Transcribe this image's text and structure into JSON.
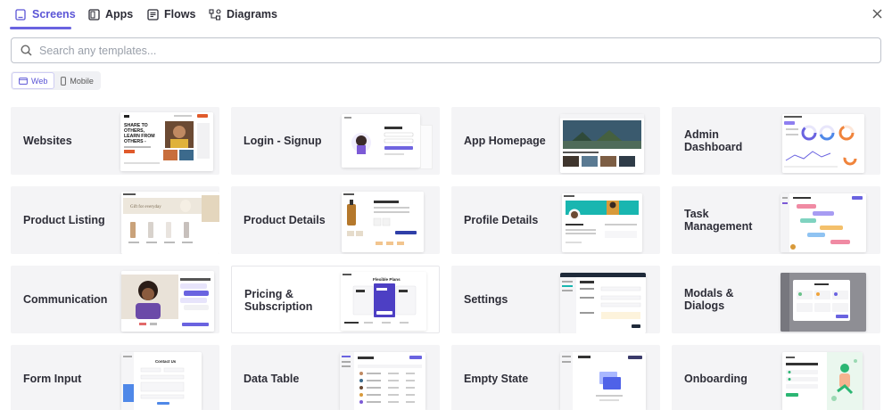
{
  "tabs": [
    {
      "label": "Screens",
      "icon": "screens-icon",
      "active": true
    },
    {
      "label": "Apps",
      "icon": "apps-icon",
      "active": false
    },
    {
      "label": "Flows",
      "icon": "flows-icon",
      "active": false
    },
    {
      "label": "Diagrams",
      "icon": "diagrams-icon",
      "active": false
    }
  ],
  "search": {
    "placeholder": "Search any templates..."
  },
  "platform_toggle": {
    "web_label": "Web",
    "mobile_label": "Mobile",
    "selected": "Web"
  },
  "categories": [
    {
      "label": "Websites"
    },
    {
      "label": "Login - Signup"
    },
    {
      "label": "App Homepage"
    },
    {
      "label": "Admin Dashboard"
    },
    {
      "label": "Product Listing"
    },
    {
      "label": "Product Details"
    },
    {
      "label": "Profile Details"
    },
    {
      "label": "Task Management"
    },
    {
      "label": "Communication"
    },
    {
      "label": "Pricing & Subscription"
    },
    {
      "label": "Settings"
    },
    {
      "label": "Modals & Dialogs"
    },
    {
      "label": "Form Input"
    },
    {
      "label": "Data Table"
    },
    {
      "label": "Empty State"
    },
    {
      "label": "Onboarding"
    }
  ],
  "thumb_text": {
    "websites_hero": "SHARE TO OTHERS, LEARN FROM OTHERS -",
    "pricing_title": "Flexible Plans",
    "listing_banner": "Gift for everyday",
    "forms_title": "Contact Us"
  },
  "colors": {
    "accent": "#5b55d6",
    "card_bg": "#f4f4f6",
    "text": "#2e2e38"
  }
}
